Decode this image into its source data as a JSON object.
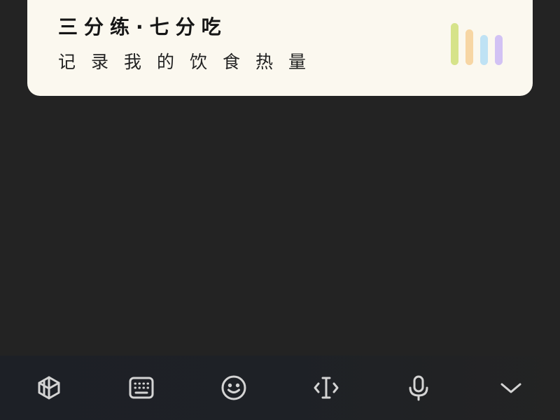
{
  "card": {
    "title": "三分练·七分吃",
    "subtitle": "记录我的饮食热量",
    "bar_colors": [
      "#D6E38A",
      "#F7D6A4",
      "#BFE2F4",
      "#D2C2F4"
    ]
  },
  "keyboard_toolbar": {
    "icons": [
      "app-logo-icon",
      "keyboard-icon",
      "emoji-icon",
      "text-cursor-icon",
      "microphone-icon",
      "chevron-down-icon"
    ],
    "icon_color": "#D4D4D4"
  }
}
